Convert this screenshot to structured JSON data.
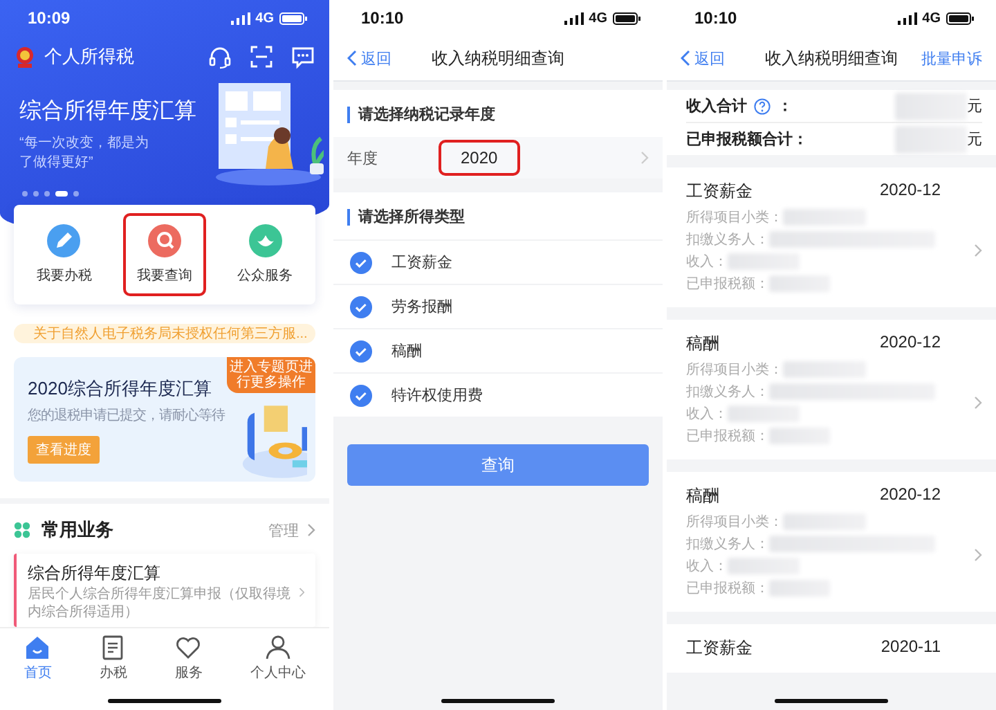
{
  "home": {
    "status_bar": {
      "time": "10:09",
      "network": "4G"
    },
    "app_name": "个人所得税",
    "banner": {
      "title": "综合所得年度汇算",
      "quote": "“每一次改变，都是为了做得更好”"
    },
    "carousel_dots": [
      {
        "selected": false
      },
      {
        "selected": false
      },
      {
        "selected": false
      },
      {
        "selected": true
      },
      {
        "selected": false
      }
    ],
    "quick_actions": [
      {
        "label": "我要办税",
        "color": "#4a9ff0",
        "highlighted": false
      },
      {
        "label": "我要查询",
        "color": "#ec6b60",
        "highlighted": true
      },
      {
        "label": "公众服务",
        "color": "#3cc595",
        "highlighted": false
      }
    ],
    "notice": "关于自然人电子税务局未授权任何第三方服...",
    "promo": {
      "title": "2020综合所得年度汇算",
      "subtitle": "您的退税申请已提交，请耐心等待",
      "button": "查看进度",
      "ribbon": "进入专题页进行更多操作"
    },
    "common": {
      "title": "常用业务",
      "action": "管理"
    },
    "business_card": {
      "title": "综合所得年度汇算",
      "description": "居民个人综合所得年度汇算申报（仅取得境内综合所得适用）"
    },
    "tabs": [
      {
        "label": "首页",
        "selected": true
      },
      {
        "label": "办税",
        "selected": false
      },
      {
        "label": "服务",
        "selected": false
      },
      {
        "label": "个人中心",
        "selected": false
      }
    ]
  },
  "query": {
    "status_bar": {
      "time": "10:10",
      "network": "4G"
    },
    "nav": {
      "back": "返回",
      "title": "收入纳税明细查询"
    },
    "year_section": "请选择纳税记录年度",
    "year": {
      "label": "年度",
      "value": "2020",
      "highlighted": true
    },
    "type_section": "请选择所得类型",
    "types": [
      {
        "label": "工资薪金",
        "checked": true
      },
      {
        "label": "劳务报酬",
        "checked": true
      },
      {
        "label": "稿酬",
        "checked": true
      },
      {
        "label": "特许权使用费",
        "checked": true
      }
    ],
    "button": "查询"
  },
  "results": {
    "status_bar": {
      "time": "10:10",
      "network": "4G"
    },
    "nav": {
      "back": "返回",
      "title": "收入纳税明细查询",
      "action": "批量申诉"
    },
    "summary": [
      {
        "label": "收入合计",
        "help": true,
        "colon": "：",
        "unit": "元"
      },
      {
        "label": "已申报税额合计：",
        "help": false,
        "unit": "元"
      }
    ],
    "records": [
      {
        "type": "工资薪金",
        "period": "2020-12",
        "fields": [
          "所得项目小类：",
          "扣缴义务人：",
          "收入：",
          "已申报税额："
        ]
      },
      {
        "type": "稿酬",
        "period": "2020-12",
        "fields": [
          "所得项目小类：",
          "扣缴义务人：",
          "收入：",
          "已申报税额："
        ]
      },
      {
        "type": "稿酬",
        "period": "2020-12",
        "fields": [
          "所得项目小类：",
          "扣缴义务人：",
          "收入：",
          "已申报税额："
        ]
      },
      {
        "type": "工资薪金",
        "period": "2020-11"
      }
    ]
  }
}
